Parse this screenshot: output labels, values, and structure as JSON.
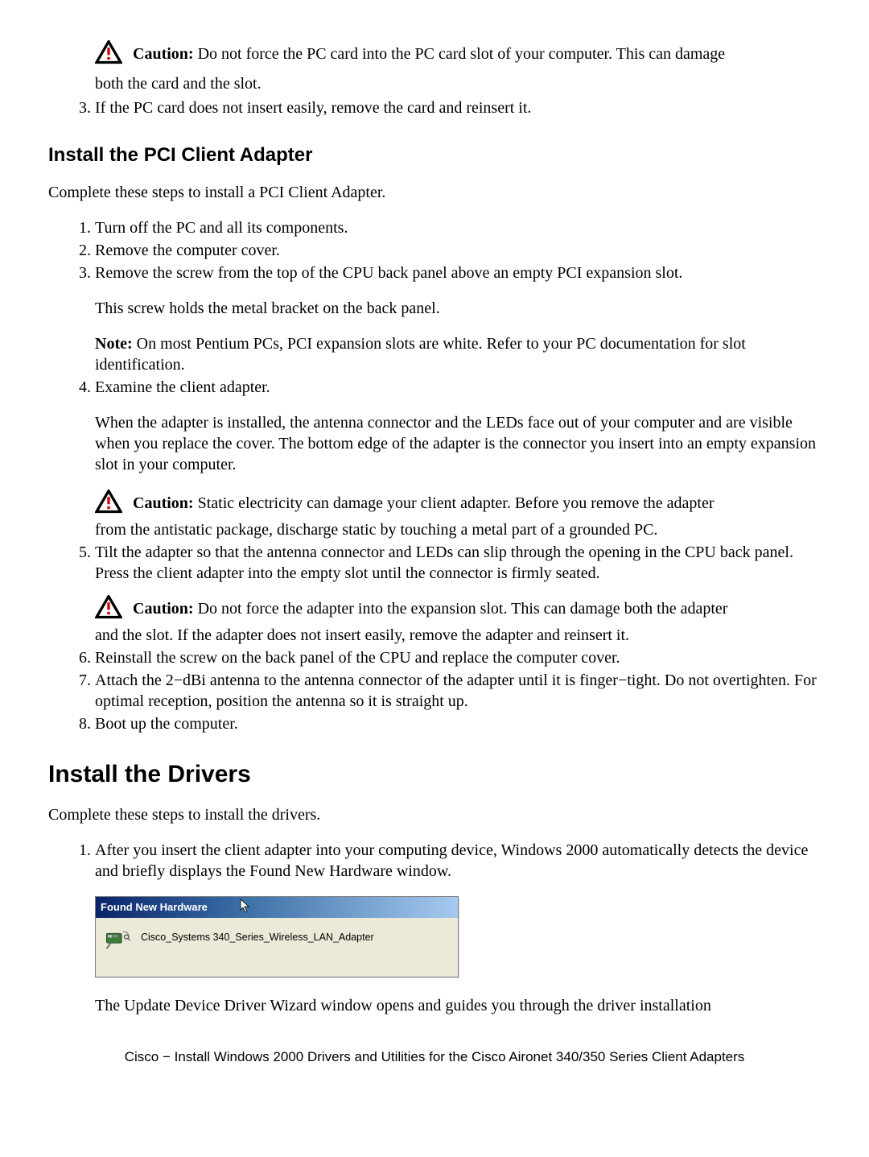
{
  "caution1": {
    "label": "Caution:",
    "text_a": " Do not force the PC card into the PC card slot of your computer. This can damage",
    "text_b": "both the card and the slot."
  },
  "top_list": {
    "start": 3,
    "item3": "If the PC card does not insert easily, remove the card and reinsert it."
  },
  "h3_pci": "Install the PCI Client Adapter",
  "p_pci_intro": "Complete these steps to install a PCI Client Adapter.",
  "pci_list": {
    "item1": "Turn off the PC and all its components.",
    "item2": "Remove the computer cover.",
    "item3": "Remove the screw from the top of the CPU back panel above an empty PCI expansion slot.",
    "item3_para": "This screw holds the metal bracket on the back panel.",
    "item3_note_label": "Note:",
    "item3_note": " On most Pentium PCs, PCI expansion slots are white. Refer to your PC documentation for slot identification.",
    "item4": "Examine the client adapter.",
    "item4_para": "When the adapter is installed, the antenna connector and the LEDs face out of your computer and are visible when you replace the cover. The bottom edge of the adapter is the connector you insert into an empty expansion slot in your computer.",
    "caution2_label": "Caution:",
    "caution2_a": " Static electricity can damage your client adapter. Before you remove the adapter",
    "caution2_b": "from the antistatic package, discharge static by touching a metal part of a grounded PC.",
    "item5": "Tilt the adapter so that the antenna connector and LEDs can slip through the opening in the CPU back panel. Press the client adapter into the empty slot until the connector is firmly seated.",
    "caution3_label": "Caution:",
    "caution3_a": " Do not force the adapter into the expansion slot. This can damage both the adapter",
    "caution3_b": "and the slot. If the adapter does not insert easily, remove the adapter and reinsert it.",
    "item6": "Reinstall the screw on the back panel of the CPU and replace the computer cover.",
    "item7": "Attach the 2−dBi antenna to the antenna connector of the adapter until it is finger−tight. Do not overtighten. For optimal reception, position the antenna so it is straight up.",
    "item8": "Boot up the computer."
  },
  "h2_drivers": "Install the Drivers",
  "p_drivers_intro": "Complete these steps to install the drivers.",
  "drivers_list": {
    "item1": "After you insert the client adapter into your computing device, Windows 2000 automatically detects the device and briefly displays the Found New Hardware window.",
    "item1_after": "The Update Device Driver Wizard window opens and guides you through the driver installation"
  },
  "window": {
    "title": "Found New Hardware",
    "body_text": "Cisco_Systems 340_Series_Wireless_LAN_Adapter"
  },
  "footer": "Cisco − Install Windows 2000 Drivers and Utilities for the Cisco Aironet 340/350 Series Client Adapters"
}
